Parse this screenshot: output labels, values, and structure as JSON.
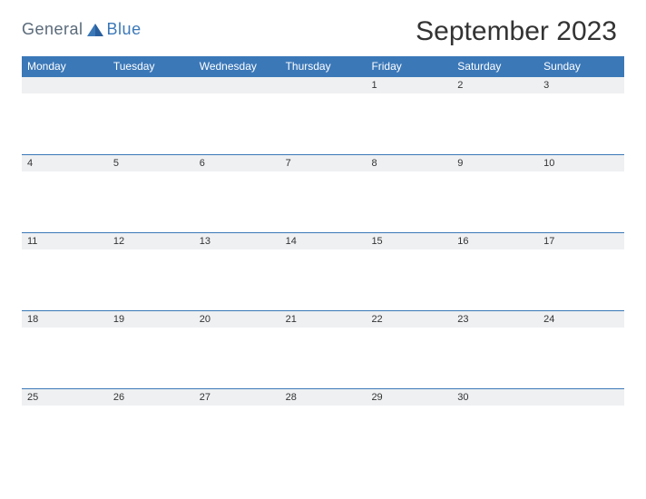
{
  "brand": {
    "name1": "General",
    "name2": "Blue"
  },
  "title": "September 2023",
  "days": [
    "Monday",
    "Tuesday",
    "Wednesday",
    "Thursday",
    "Friday",
    "Saturday",
    "Sunday"
  ],
  "weeks": [
    [
      "",
      "",
      "",
      "",
      "1",
      "2",
      "3"
    ],
    [
      "4",
      "5",
      "6",
      "7",
      "8",
      "9",
      "10"
    ],
    [
      "11",
      "12",
      "13",
      "14",
      "15",
      "16",
      "17"
    ],
    [
      "18",
      "19",
      "20",
      "21",
      "22",
      "23",
      "24"
    ],
    [
      "25",
      "26",
      "27",
      "28",
      "29",
      "30",
      ""
    ]
  ]
}
